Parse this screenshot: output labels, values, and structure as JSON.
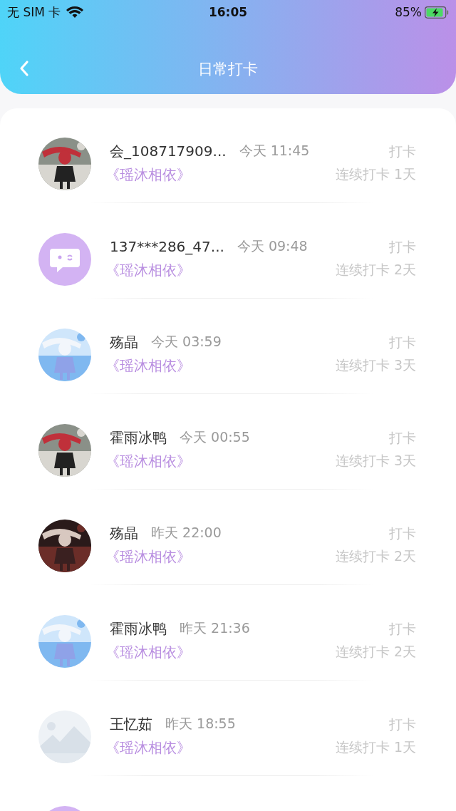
{
  "status_bar": {
    "carrier": "无 SIM 卡",
    "time": "16:05",
    "battery": "85%"
  },
  "header": {
    "title": "日常打卡"
  },
  "records": [
    {
      "name": "会_108717909...",
      "time": "今天 11:45",
      "book": "《瑶沐相依》",
      "action": "打卡",
      "streak": "连续打卡 1天"
    },
    {
      "kind": "default",
      "name": "137***286_47...",
      "time": "今天 09:48",
      "book": "《瑶沐相依》",
      "action": "打卡",
      "streak": "连续打卡 2天"
    },
    {
      "name": "殇晶",
      "time": "今天 03:59",
      "book": "《瑶沐相依》",
      "action": "打卡",
      "streak": "连续打卡 3天"
    },
    {
      "name": "霍雨冰鸭",
      "time": "今天 00:55",
      "book": "《瑶沐相依》",
      "action": "打卡",
      "streak": "连续打卡 3天"
    },
    {
      "name": "殇晶",
      "time": "昨天 22:00",
      "book": "《瑶沐相依》",
      "action": "打卡",
      "streak": "连续打卡 2天"
    },
    {
      "name": "霍雨冰鸭",
      "time": "昨天 21:36",
      "book": "《瑶沐相依》",
      "action": "打卡",
      "streak": "连续打卡 2天"
    },
    {
      "kind": "placeholder",
      "name": "王忆茹",
      "time": "昨天 18:55",
      "book": "《瑶沐相依》",
      "action": "打卡",
      "streak": "连续打卡 1天"
    },
    {
      "kind": "default"
    }
  ]
}
